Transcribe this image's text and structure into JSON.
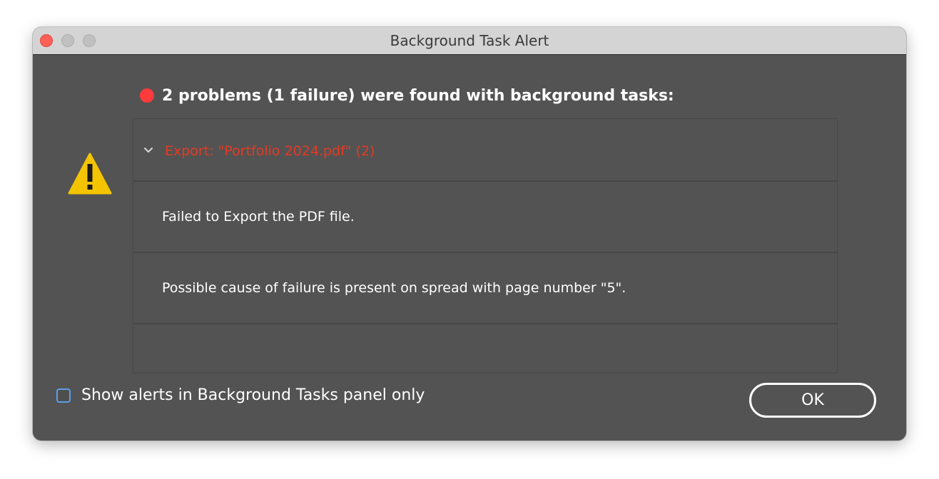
{
  "window": {
    "title": "Background Task Alert"
  },
  "alert": {
    "icon": "warning-triangle-icon",
    "status_icon": "red-dot-icon",
    "headline": "2 problems (1 failure) were found with background tasks:",
    "groups": [
      {
        "label": "Export: \"Portfolio 2024.pdf\" (2)",
        "expanded": true,
        "messages": [
          "Failed to Export the PDF file.",
          "Possible cause of failure is present on spread with page number \"5\"."
        ]
      }
    ]
  },
  "footer": {
    "checkbox_label": "Show alerts in Background Tasks panel only",
    "checkbox_checked": false,
    "ok_label": "OK"
  },
  "colors": {
    "dialog_bg": "#535353",
    "titlebar_bg": "#d5d4d5",
    "error_red": "#e53a24",
    "status_dot": "#ff3b3b",
    "warning_yellow": "#f4c400",
    "checkbox_blue": "#5aa0ea"
  }
}
